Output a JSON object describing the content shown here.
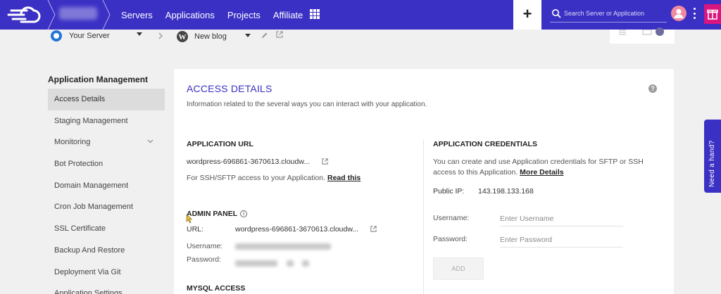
{
  "topbar": {
    "nav": [
      "Servers",
      "Applications",
      "Projects",
      "Affiliate"
    ],
    "plus_label": "+",
    "search_placeholder": "Search Server or Application"
  },
  "subbar": {
    "server_label": "Your Server",
    "app_label": "New blog"
  },
  "sidebar": {
    "title": "Application Management",
    "items": [
      "Access Details",
      "Staging Management",
      "Monitoring",
      "Bot Protection",
      "Domain Management",
      "Cron Job Management",
      "SSL Certificate",
      "Backup And Restore",
      "Deployment Via Git",
      "Application Settings"
    ]
  },
  "access": {
    "title": "ACCESS DETAILS",
    "subtitle": "Information related to the several ways you can interact with your application.",
    "help_glyph": "?",
    "app_url": {
      "heading": "APPLICATION URL",
      "url": "wordpress-696861-3670613.cloudw...",
      "ssh_text": "For SSH/SFTP access to your Application.",
      "read_this": "Read this"
    },
    "admin": {
      "heading": "ADMIN PANEL",
      "url_label": "URL:",
      "url_value": "wordpress-696861-3670613.cloudw...",
      "username_label": "Username:",
      "password_label": "Password:"
    },
    "mysql_heading": "MYSQL ACCESS",
    "credentials": {
      "heading": "APPLICATION CREDENTIALS",
      "text_line1": "You can create and use Application credentials for SFTP or SSH",
      "text_line2": "access to this Application.",
      "more_details": "More Details",
      "public_ip_label": "Public IP:",
      "public_ip_value": "143.198.133.168",
      "username_label": "Username:",
      "username_placeholder": "Enter Username",
      "password_label": "Password:",
      "password_placeholder": "Enter Password",
      "add_label": "ADD"
    }
  },
  "help_tab": "Need a hand?"
}
